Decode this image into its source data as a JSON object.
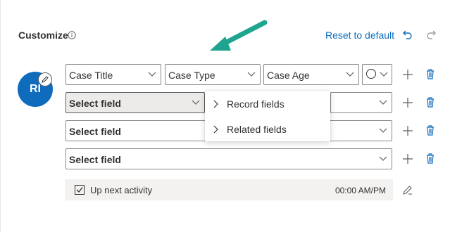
{
  "header": {
    "title": "Customize",
    "info_icon": "info-icon",
    "reset_label": "Reset to default",
    "undo_icon": "undo-icon",
    "redo_icon": "redo-icon"
  },
  "avatar": {
    "initials": "RI",
    "edit_icon": "pencil-icon",
    "color": "#0f6cbd"
  },
  "rows": [
    {
      "fields": [
        "Case Title",
        "Case Type",
        "Case Age"
      ],
      "extra": "circle-icon"
    },
    {
      "fields": [
        "Select field"
      ],
      "state": "dropdown-open"
    },
    {
      "fields": [
        "Select field"
      ]
    },
    {
      "fields": [
        "Select field"
      ]
    }
  ],
  "flyout": {
    "items": [
      "Record fields",
      "Related fields"
    ]
  },
  "activity": {
    "label": "Up next activity",
    "time": "00:00 AM/PM",
    "checked": true
  },
  "colors": {
    "accent": "#0f6cbd",
    "delete": "#0f6cbd",
    "arrow": "#1fa58f"
  }
}
